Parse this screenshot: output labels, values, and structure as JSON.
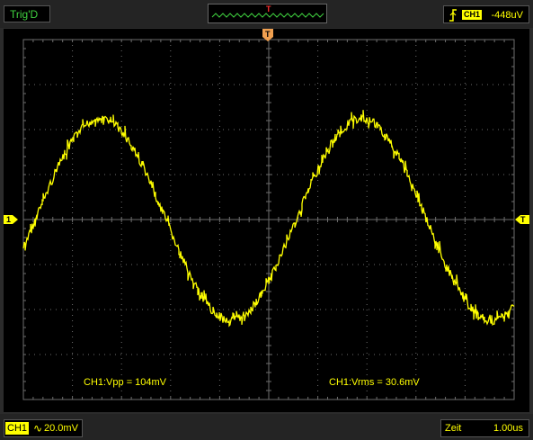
{
  "header": {
    "trigger_status": "Trig'D",
    "trigger_marker": "T",
    "channel_badge": "CH1",
    "trigger_level": "-448uV"
  },
  "screen": {
    "channel_marker": "1",
    "trigger_level_marker": "T",
    "trigger_pos_marker": "T",
    "measure_vpp": "CH1:Vpp = 104mV",
    "measure_vrms": "CH1:Vrms = 30.6mV",
    "grid_divisions": {
      "horizontal": 11,
      "vertical": 8
    }
  },
  "footer": {
    "channel_badge": "CH1",
    "coupling_symbol": "∿",
    "volts_per_div": "20.0mV",
    "time_label": "Zeit",
    "time_per_div": "1.00us"
  },
  "colors": {
    "trace": "#ffff00",
    "grid": "#6e6e6e",
    "trigger_marker": "#f0a050",
    "status_text": "#3fd03f"
  }
}
